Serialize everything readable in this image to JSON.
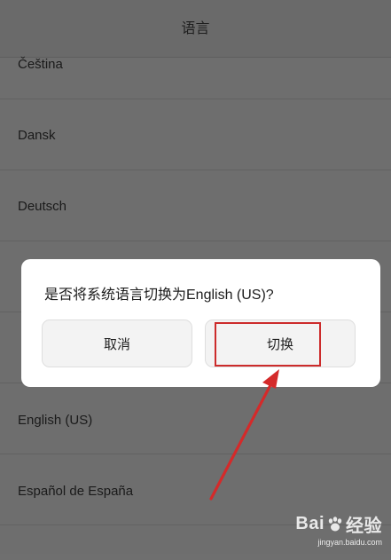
{
  "header": {
    "title": "语言"
  },
  "languages": [
    "Čeština",
    "Dansk",
    "Deutsch",
    "",
    "",
    "English (US)",
    "Español de España",
    ""
  ],
  "dialog": {
    "message": "是否将系统语言切换为English (US)?",
    "cancel_label": "取消",
    "switch_label": "切换"
  },
  "watermark": {
    "logo_left": "Bai",
    "logo_right": "经验",
    "url": "jingyan.baidu.com"
  },
  "colors": {
    "highlight": "#cc2b2b",
    "arrow": "#d42a2a",
    "overlay": "#6e6e6e",
    "dialog_bg": "#ffffff"
  }
}
